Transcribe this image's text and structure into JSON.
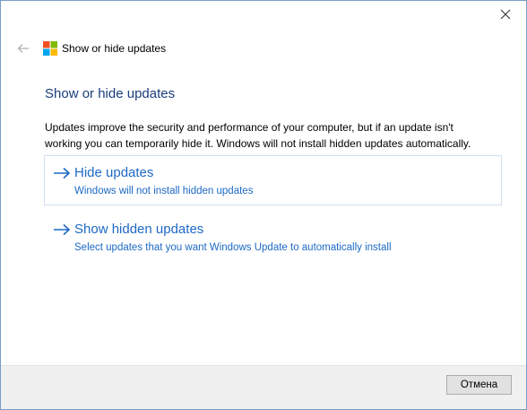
{
  "window": {
    "title": "Show or hide updates"
  },
  "main": {
    "page_title": "Show or hide updates",
    "description": "Updates improve the security and performance of your computer, but if an update isn't working you can temporarily hide it. Windows will not install hidden updates automatically.",
    "options": [
      {
        "title": "Hide updates",
        "subtitle": "Windows will not install hidden updates"
      },
      {
        "title": "Show hidden updates",
        "subtitle": "Select updates that you want Windows Update to automatically install"
      }
    ]
  },
  "footer": {
    "cancel_label": "Отмена"
  },
  "colors": {
    "link": "#1d69c4",
    "title": "#1a3d7c",
    "footer_bg": "#f0f0f0"
  },
  "icons": [
    "close-icon",
    "back-arrow-icon",
    "windows-logo-icon",
    "arrow-right-icon"
  ]
}
